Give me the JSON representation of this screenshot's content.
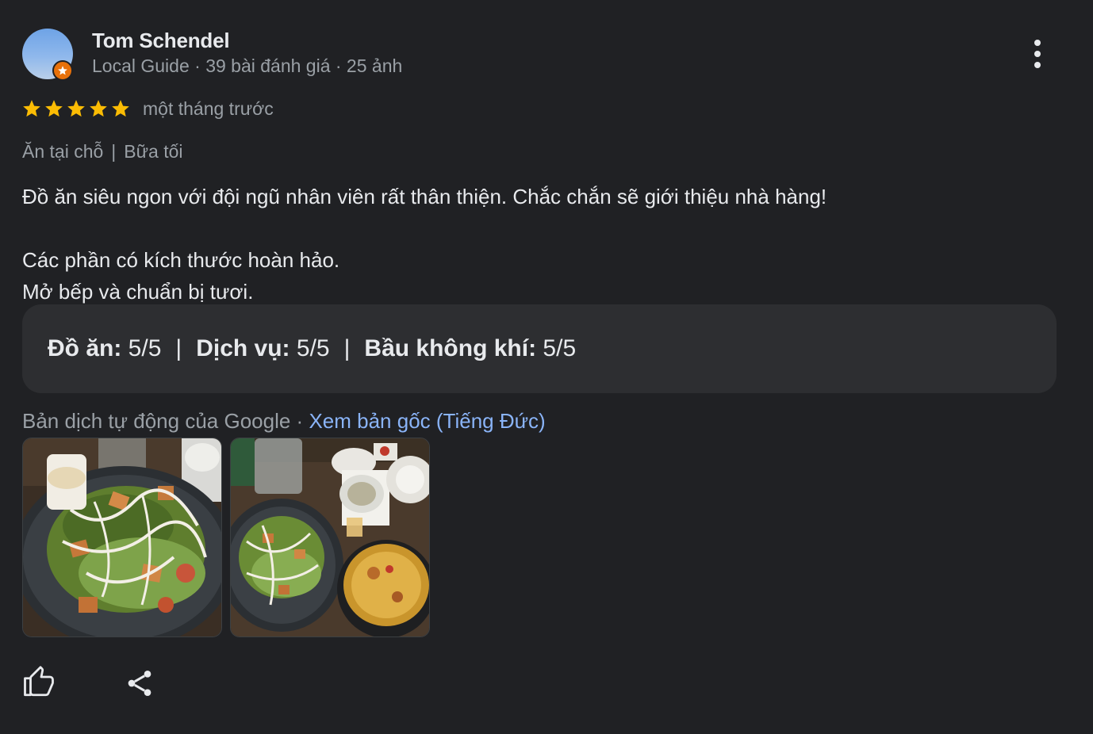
{
  "author": {
    "name": "Tom Schendel",
    "meta": "Local Guide · 39 bài đánh giá · 25 ảnh",
    "avatar_icon": "avatar-photo",
    "badge_icon": "local-guide-star-icon"
  },
  "rating": {
    "stars": 5,
    "max_stars": 5,
    "date": "một tháng trước",
    "star_color": "#fbbc04"
  },
  "visit": {
    "service": "Ăn tại chỗ",
    "separator": "|",
    "meal": "Bữa tối"
  },
  "review": {
    "line1": "Đồ ăn siêu ngon với đội ngũ nhân viên rất thân thiện. Chắc chắn sẽ giới thiệu nhà hàng!",
    "line2": "Các phần có kích thước hoàn hảo.",
    "line3": "Mở bếp và chuẩn bị tươi."
  },
  "aspect_ratings": {
    "food_label": "Đồ ăn:",
    "food_value": "5/5",
    "service_label": "Dịch vụ:",
    "service_value": "5/5",
    "atmosphere_label": "Bầu không khí:",
    "atmosphere_value": "5/5",
    "separator": "|"
  },
  "translation": {
    "note": "Bản dịch tự động của Google",
    "dot": "·",
    "link": "Xem bản gốc (Tiếng Đức)",
    "link_color": "#8ab4f8"
  },
  "photos": [
    {
      "icon": "salad-photo"
    },
    {
      "icon": "salad-and-curry-photo"
    }
  ],
  "actions": {
    "like_icon": "thumbs-up-icon",
    "share_icon": "share-icon",
    "menu_icon": "more-vert-icon"
  }
}
